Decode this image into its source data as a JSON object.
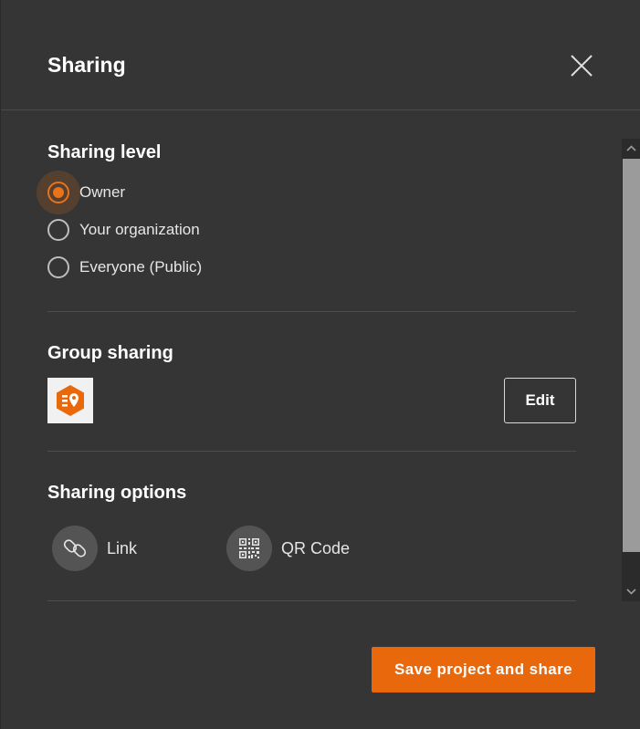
{
  "dialog": {
    "title": "Sharing"
  },
  "sharing_level": {
    "heading": "Sharing level",
    "options": [
      {
        "label": "Owner",
        "selected": true
      },
      {
        "label": "Your organization",
        "selected": false
      },
      {
        "label": "Everyone (Public)",
        "selected": false
      }
    ]
  },
  "group_sharing": {
    "heading": "Group sharing",
    "group_icon": "survey-app-icon",
    "edit_label": "Edit"
  },
  "sharing_options": {
    "heading": "Sharing options",
    "items": [
      {
        "label": "Link",
        "icon": "link-icon"
      },
      {
        "label": "QR Code",
        "icon": "qr-code-icon"
      }
    ]
  },
  "footer": {
    "save_label": "Save project and share"
  },
  "colors": {
    "accent": "#e8680b",
    "background": "#353535"
  }
}
